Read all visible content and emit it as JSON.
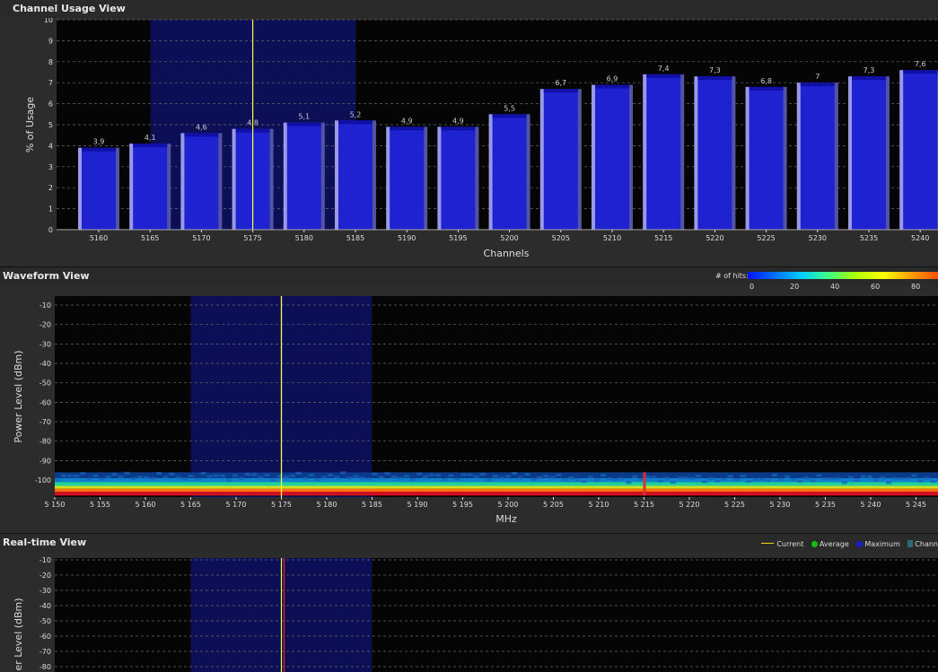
{
  "panels": {
    "channel_usage": {
      "title": "Channel Usage View",
      "ylabel": "% of Usage",
      "xlabel": "Channels",
      "yticks": [
        "0",
        "1",
        "2",
        "3",
        "4",
        "5",
        "6",
        "7",
        "8",
        "9",
        "10"
      ]
    },
    "waveform": {
      "title": "Waveform View",
      "ylabel": "Power Level (dBm)",
      "xlabel": "MHz",
      "yticks": [
        "-10",
        "-20",
        "-30",
        "-40",
        "-50",
        "-60",
        "-70",
        "-80",
        "-90",
        "-100"
      ],
      "xticks": [
        "5 150",
        "5 155",
        "5 160",
        "5 165",
        "5 170",
        "5 175",
        "5 180",
        "5 185",
        "5 190",
        "5 195",
        "5 200",
        "5 205",
        "5 210",
        "5 215",
        "5 220",
        "5 225",
        "5 230",
        "5 235",
        "5 240",
        "5 245"
      ],
      "legend_title": "# of hits:",
      "legend_ticks": [
        "0",
        "20",
        "40",
        "60",
        "80"
      ]
    },
    "realtime": {
      "title": "Real-time View",
      "ylabel": "er Level (dBm)",
      "yticks": [
        "-10",
        "-20",
        "-30",
        "-40",
        "-50",
        "-60",
        "-70",
        "-80"
      ],
      "legend": {
        "current": "Current",
        "average": "Average",
        "maximum": "Maximum",
        "channel": "Chann"
      }
    }
  },
  "colors": {
    "bar": "#1e22d0",
    "bar_cap": "#1010a8",
    "selection": "#0c0f55",
    "cursor": "#ffff40",
    "realtime_cursor": "#e02020",
    "average": "#10c010",
    "maximum": "#1020d0",
    "channel": "#2a6a7a"
  },
  "chart_data": [
    {
      "type": "bar",
      "title": "Channel Usage View",
      "xlabel": "Channels",
      "ylabel": "% of Usage",
      "ylim": [
        0,
        10
      ],
      "categories": [
        "5160",
        "5165",
        "5170",
        "5175",
        "5180",
        "5185",
        "5190",
        "5195",
        "5200",
        "5205",
        "5210",
        "5215",
        "5220",
        "5225",
        "5230",
        "5235",
        "5240"
      ],
      "values": [
        3.9,
        4.1,
        4.6,
        4.8,
        5.1,
        5.2,
        4.9,
        4.9,
        5.5,
        6.7,
        6.9,
        7.4,
        7.3,
        6.8,
        7,
        7.3,
        7.6
      ],
      "value_labels": [
        "3,9",
        "4,1",
        "4,6",
        "4,8",
        "5,1",
        "5,2",
        "4,9",
        "4,9",
        "5,5",
        "6,7",
        "6,9",
        "7,4",
        "7,3",
        "6,8",
        "7",
        "7,3",
        "7,6"
      ],
      "cursor_channel": 5175,
      "selection_range": [
        5165,
        5185
      ],
      "grid": true
    },
    {
      "type": "heatmap",
      "title": "Waveform View",
      "xlabel": "MHz",
      "ylabel": "Power Level (dBm)",
      "xlim": [
        5150,
        5248
      ],
      "ylim": [
        -105,
        -5
      ],
      "cursor_mhz": 5175,
      "selection_range": [
        5165,
        5185
      ],
      "grid": true
    }
  ]
}
